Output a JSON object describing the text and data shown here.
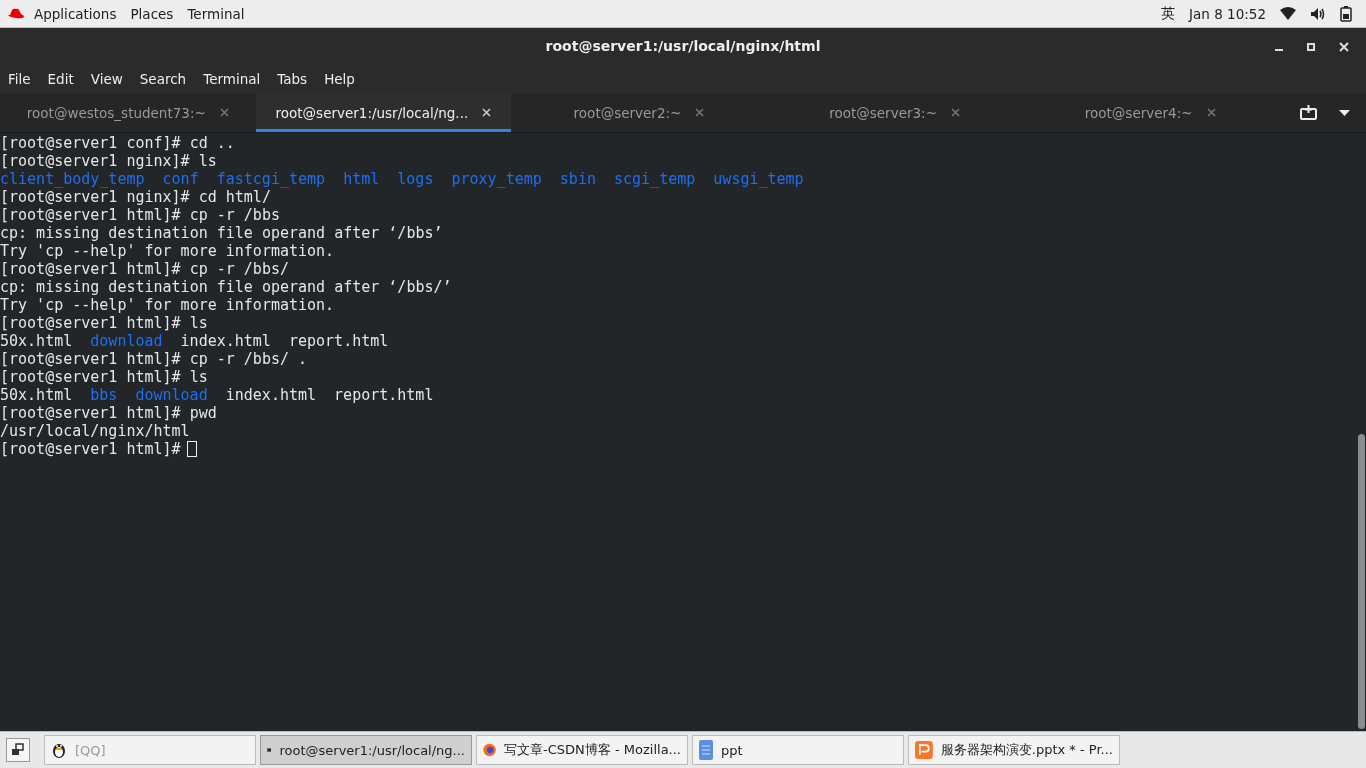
{
  "top_bar": {
    "menus": [
      "Applications",
      "Places",
      "Terminal"
    ],
    "input_method": "英",
    "clock": "Jan 8  10:52"
  },
  "window": {
    "title": "root@server1:/usr/local/nginx/html"
  },
  "menu_bar": [
    "File",
    "Edit",
    "View",
    "Search",
    "Terminal",
    "Tabs",
    "Help"
  ],
  "tabs": [
    {
      "label": "root@westos_student73:~",
      "selected": false
    },
    {
      "label": "root@server1:/usr/local/ng...",
      "selected": true
    },
    {
      "label": "root@server2:~",
      "selected": false
    },
    {
      "label": "root@server3:~",
      "selected": false
    },
    {
      "label": "root@server4:~",
      "selected": false
    }
  ],
  "terminal": {
    "cursor": true,
    "lines": [
      [
        {
          "text": "[root@server1 conf]# cd ..",
          "kind": "plain"
        }
      ],
      [
        {
          "text": "[root@server1 nginx]# ls",
          "kind": "plain"
        }
      ],
      [
        {
          "text": "client_body_temp",
          "kind": "dir"
        },
        {
          "text": "conf",
          "kind": "dir"
        },
        {
          "text": "fastcgi_temp",
          "kind": "dir"
        },
        {
          "text": "html",
          "kind": "dir"
        },
        {
          "text": "logs",
          "kind": "dir"
        },
        {
          "text": "proxy_temp",
          "kind": "dir"
        },
        {
          "text": "sbin",
          "kind": "dir"
        },
        {
          "text": "scgi_temp",
          "kind": "dir"
        },
        {
          "text": "uwsgi_temp",
          "kind": "dir"
        }
      ],
      [
        {
          "text": "[root@server1 nginx]# cd html/",
          "kind": "plain"
        }
      ],
      [
        {
          "text": "[root@server1 html]# cp -r /bbs",
          "kind": "plain"
        }
      ],
      [
        {
          "text": "cp: missing destination file operand after ‘/bbs’",
          "kind": "plain"
        }
      ],
      [
        {
          "text": "Try 'cp --help' for more information.",
          "kind": "plain"
        }
      ],
      [
        {
          "text": "[root@server1 html]# cp -r /bbs/",
          "kind": "plain"
        }
      ],
      [
        {
          "text": "cp: missing destination file operand after ‘/bbs/’",
          "kind": "plain"
        }
      ],
      [
        {
          "text": "Try 'cp --help' for more information.",
          "kind": "plain"
        }
      ],
      [
        {
          "text": "[root@server1 html]# ls",
          "kind": "plain"
        }
      ],
      [
        {
          "text": "50x.html",
          "kind": "file"
        },
        {
          "text": "download",
          "kind": "dir"
        },
        {
          "text": "index.html",
          "kind": "file"
        },
        {
          "text": "report.html",
          "kind": "file"
        }
      ],
      [
        {
          "text": "[root@server1 html]# cp -r /bbs/ .",
          "kind": "plain"
        }
      ],
      [
        {
          "text": "[root@server1 html]# ls",
          "kind": "plain"
        }
      ],
      [
        {
          "text": "50x.html",
          "kind": "file"
        },
        {
          "text": "bbs",
          "kind": "dir"
        },
        {
          "text": "download",
          "kind": "dir"
        },
        {
          "text": "index.html",
          "kind": "file"
        },
        {
          "text": "report.html",
          "kind": "file"
        }
      ],
      [
        {
          "text": "[root@server1 html]# pwd",
          "kind": "plain"
        }
      ],
      [
        {
          "text": "/usr/local/nginx/html",
          "kind": "plain"
        }
      ],
      [
        {
          "text": "[root@server1 html]#",
          "kind": "plain"
        }
      ]
    ]
  },
  "taskbar": [
    {
      "label": "[QQ]",
      "selected": false,
      "minimized": true
    },
    {
      "label": "root@server1:/usr/local/ng...",
      "selected": true,
      "minimized": false
    },
    {
      "label": "写文章-CSDN博客 - Mozilla...",
      "selected": false,
      "minimized": false
    },
    {
      "label": "ppt",
      "selected": false,
      "minimized": false
    },
    {
      "label": "服务器架构演变.pptx * - Pr...",
      "selected": false,
      "minimized": false
    }
  ]
}
